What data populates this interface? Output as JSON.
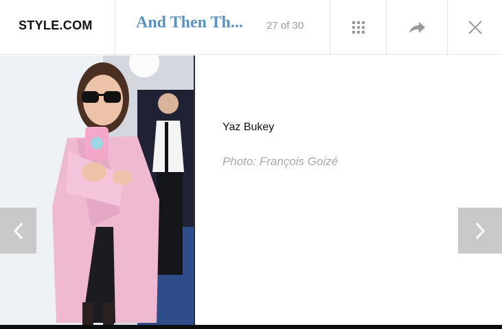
{
  "header": {
    "logo": "STYLE.COM",
    "gallery_title": "And Then Th...",
    "counter": "27 of 30",
    "icons": {
      "grid": "grid-icon",
      "share": "share-arrow-icon",
      "close": "close-icon"
    }
  },
  "slide": {
    "name": "Yaz Bukey",
    "credit": "Photo: François Goizé"
  },
  "nav": {
    "prev": "chevron-left-icon",
    "next": "chevron-right-icon"
  },
  "colors": {
    "title_blue": "#5b93c0",
    "coat_pink": "#f0b9d2",
    "arrow_bg": "#c9c9c9"
  }
}
